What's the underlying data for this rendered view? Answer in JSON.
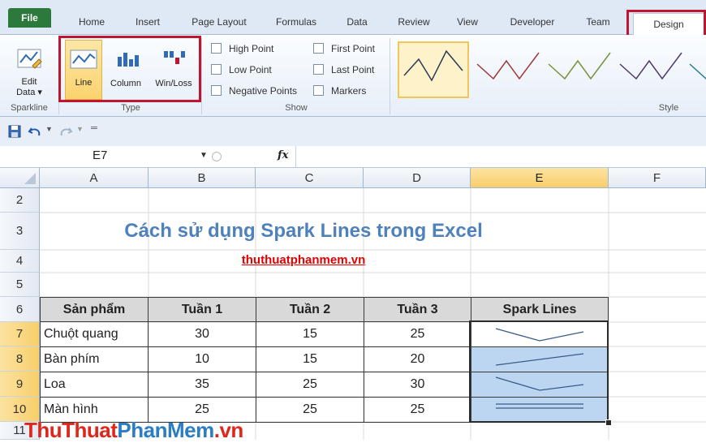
{
  "ribbon": {
    "tabs": [
      "File",
      "Home",
      "Insert",
      "Page Layout",
      "Formulas",
      "Data",
      "Review",
      "View",
      "Developer",
      "Team",
      "Design"
    ],
    "groups": {
      "sparkline": {
        "label": "Sparkline",
        "edit_data": "Edit",
        "edit_data2": "Data ▾"
      },
      "type": {
        "label": "Type",
        "line": "Line",
        "column": "Column",
        "winloss": "Win/Loss"
      },
      "show": {
        "label": "Show",
        "high": "High Point",
        "low": "Low Point",
        "negative": "Negative Points",
        "first": "First Point",
        "last": "Last Point",
        "markers": "Markers"
      },
      "style": {
        "label": "Style"
      }
    }
  },
  "formula_bar": {
    "name_box": "E7",
    "fx": "fx",
    "formula": ""
  },
  "columns": [
    "A",
    "B",
    "C",
    "D",
    "E",
    "F"
  ],
  "rows": [
    "2",
    "3",
    "4",
    "5",
    "6",
    "7",
    "8",
    "9",
    "10",
    "11"
  ],
  "sheet": {
    "title": "Cách sử dụng Spark Lines trong Excel",
    "link": "thuthuatphanmem.vn",
    "headers": [
      "Sản phẩm",
      "Tuần 1",
      "Tuần 2",
      "Tuần 3",
      "Spark Lines"
    ],
    "data": [
      {
        "name": "Chuột quang",
        "w1": "30",
        "w2": "15",
        "w3": "25"
      },
      {
        "name": "Bàn phím",
        "w1": "10",
        "w2": "15",
        "w3": "20"
      },
      {
        "name": "Loa",
        "w1": "35",
        "w2": "25",
        "w3": "30"
      },
      {
        "name": "Màn hình",
        "w1": "25",
        "w2": "25",
        "w3": "25"
      }
    ]
  },
  "watermark": {
    "part1": "ThuThuat",
    "part2": "PhanMem",
    "part3": ".vn"
  },
  "colors": {
    "accent_red": "#c0152f",
    "title_blue": "#4f81bd",
    "sel_blue": "#bcd6f2",
    "file_green": "#2b7a3b"
  }
}
